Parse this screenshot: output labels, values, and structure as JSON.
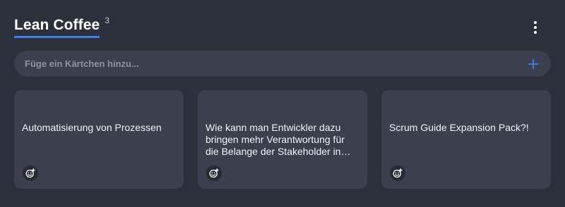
{
  "column": {
    "title": "Lean Coffee",
    "count": "3"
  },
  "menu": {
    "icon": "more-vertical-icon"
  },
  "add_card": {
    "placeholder": "Füge ein Kärtchen hinzu...",
    "value": "",
    "button_icon": "plus-icon"
  },
  "cards": [
    {
      "text": "Automatisierung von Prozessen",
      "reaction_icon": "add-reaction-icon"
    },
    {
      "text": "Wie kann man Entwickler dazu bringen mehr Verantwortung für die Belange der Stakeholder in…",
      "reaction_icon": "add-reaction-icon"
    },
    {
      "text": "Scrum Guide Expansion Pack?!",
      "reaction_icon": "add-reaction-icon"
    }
  ],
  "colors": {
    "background": "#2b303a",
    "surface": "#3a404e",
    "accent": "#3f7fe6"
  }
}
